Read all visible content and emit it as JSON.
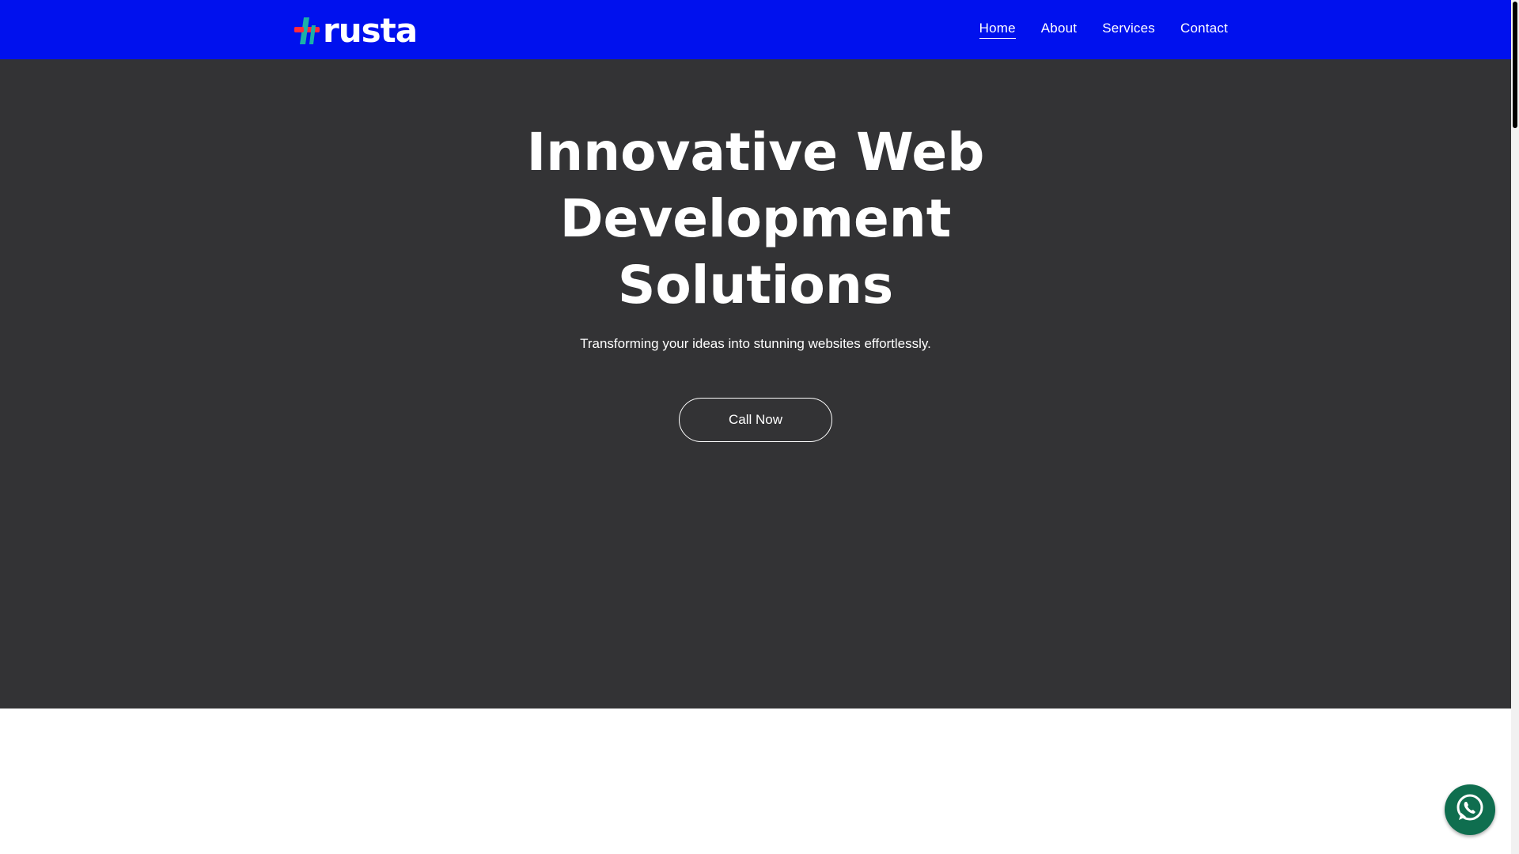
{
  "brand": {
    "name": "rusta",
    "logo_icon": "cross-logo-icon",
    "logo_colors": {
      "red": "#ff2a3d",
      "teal": "#1bb0a8",
      "wordmark": "#ffffff"
    }
  },
  "nav": {
    "items": [
      {
        "label": "Home",
        "active": true
      },
      {
        "label": "About",
        "active": false
      },
      {
        "label": "Services",
        "active": false
      },
      {
        "label": "Contact",
        "active": false
      }
    ]
  },
  "hero": {
    "title_lines": [
      "Innovative Web",
      "Development",
      "Solutions"
    ],
    "subtitle": "Transforming your ideas into stunning websites effortlessly.",
    "cta_label": "Call Now"
  },
  "floating": {
    "whatsapp_icon": "whatsapp-icon"
  },
  "colors": {
    "navbar": "#0011ee",
    "hero_background": "#333335",
    "text": "#ffffff",
    "whatsapp": "#0f6e4f"
  }
}
